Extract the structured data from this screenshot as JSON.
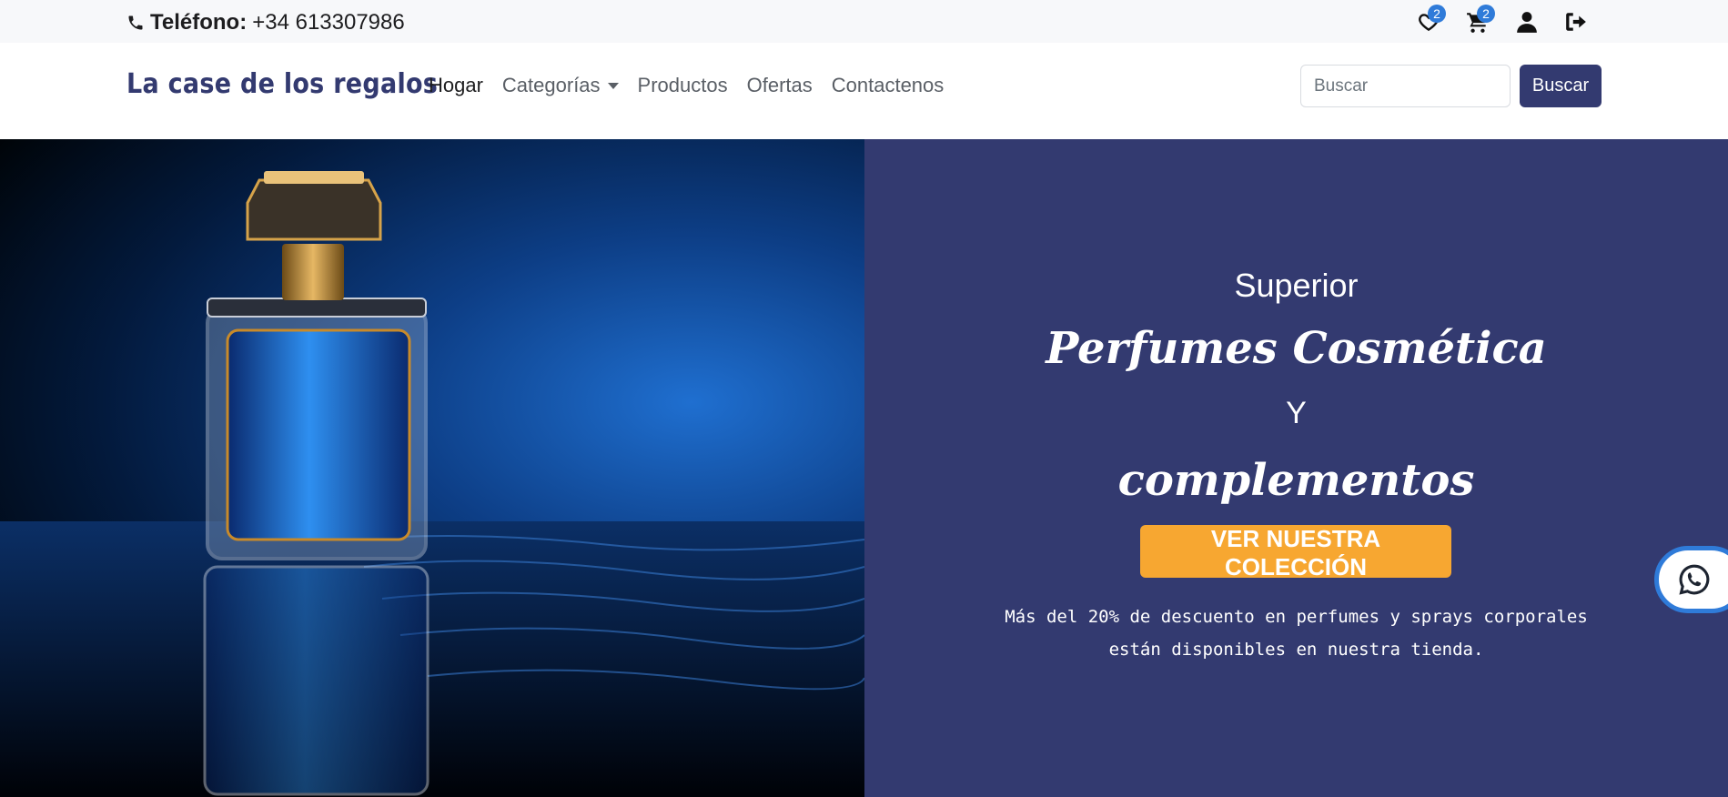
{
  "topbar": {
    "phone_label": "Teléfono:",
    "phone_number": "+34 613307986",
    "wishlist_count": "2",
    "cart_count": "2"
  },
  "navbar": {
    "brand": "La case de los regalos",
    "items": [
      {
        "label": "Hogar"
      },
      {
        "label": "Categorías"
      },
      {
        "label": "Productos"
      },
      {
        "label": "Ofertas"
      },
      {
        "label": "Contactenos"
      }
    ],
    "search_placeholder": "Buscar",
    "search_button": "Buscar"
  },
  "hero": {
    "line1": "Superior",
    "line2": "Perfumes Cosmética",
    "line3": "Y",
    "line4": "complementos",
    "cta": "VER NUESTRA COLECCIÓN",
    "description": "Más del 20% de descuento en perfumes y sprays corporales están disponibles en nuestra tienda."
  },
  "colors": {
    "brand": "#333a70",
    "accent": "#f7a731",
    "badge": "#2f7bd9"
  },
  "icons": [
    "phone-icon",
    "heart-icon",
    "cart-icon",
    "user-icon",
    "logout-icon",
    "whatsapp-icon"
  ]
}
